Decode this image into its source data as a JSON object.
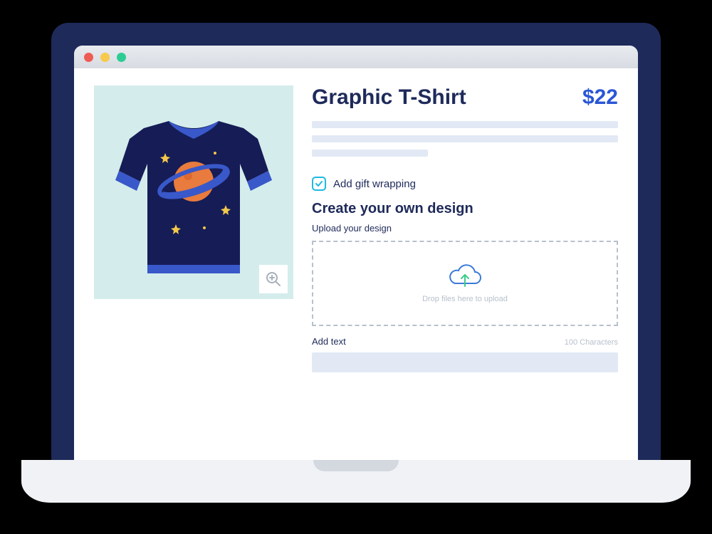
{
  "product": {
    "title": "Graphic T-Shirt",
    "price": "$22"
  },
  "options": {
    "gift_wrapping_label": "Add gift wrapping"
  },
  "design": {
    "heading": "Create your own design",
    "upload_label": "Upload your design",
    "upload_hint": "Drop files here to upload",
    "add_text_label": "Add text",
    "char_limit": "100 Characters",
    "text_value": ""
  },
  "colors": {
    "accent": "#2a56d6",
    "dark": "#1e2a5a",
    "cyan": "#1fb9e0"
  }
}
